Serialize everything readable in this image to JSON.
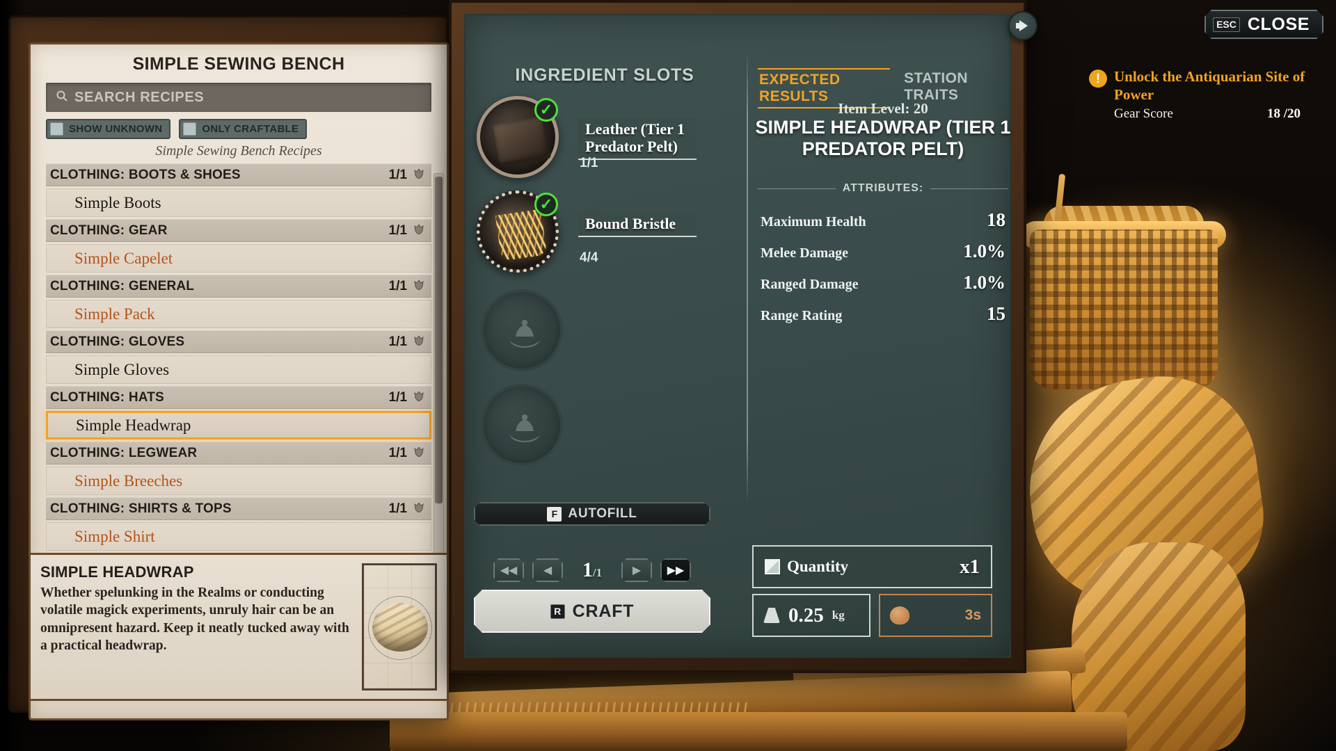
{
  "hud": {
    "mute_icon": "speaker-icon",
    "close_key": "ESC",
    "close_label": "CLOSE"
  },
  "quest": {
    "icon": "quest-alert-icon",
    "icon_glyph": "!",
    "title": "Unlock the Antiquarian Site of Power",
    "objective_label": "Gear Score",
    "objective_value": "18 /20"
  },
  "recipe_panel": {
    "title": "SIMPLE SEWING BENCH",
    "search": {
      "placeholder": "SEARCH RECIPES",
      "value": "",
      "icon": "search-icon"
    },
    "filters": [
      {
        "label": "SHOW UNKNOWN",
        "checked": false
      },
      {
        "label": "ONLY CRAFTABLE",
        "checked": false
      }
    ],
    "section_label": "Simple Sewing Bench Recipes",
    "count_icon": "crown-icon",
    "groups": [
      {
        "category": "CLOTHING: BOOTS & SHOES",
        "count": "1/1",
        "items": [
          {
            "name": "Simple Boots",
            "state": "known",
            "selected": false
          }
        ]
      },
      {
        "category": "CLOTHING: GEAR",
        "count": "1/1",
        "items": [
          {
            "name": "Simple Capelet",
            "state": "unknown",
            "selected": false
          }
        ]
      },
      {
        "category": "CLOTHING: GENERAL",
        "count": "1/1",
        "items": [
          {
            "name": "Simple Pack",
            "state": "unknown",
            "selected": false
          }
        ]
      },
      {
        "category": "CLOTHING: GLOVES",
        "count": "1/1",
        "items": [
          {
            "name": "Simple Gloves",
            "state": "known",
            "selected": false
          }
        ]
      },
      {
        "category": "CLOTHING: HATS",
        "count": "1/1",
        "items": [
          {
            "name": "Simple Headwrap",
            "state": "known",
            "selected": true
          }
        ]
      },
      {
        "category": "CLOTHING: LEGWEAR",
        "count": "1/1",
        "items": [
          {
            "name": "Simple Breeches",
            "state": "unknown",
            "selected": false
          }
        ]
      },
      {
        "category": "CLOTHING: SHIRTS & TOPS",
        "count": "1/1",
        "items": [
          {
            "name": "Simple Shirt",
            "state": "unknown",
            "selected": false
          }
        ]
      }
    ]
  },
  "description": {
    "title": "SIMPLE HEADWRAP",
    "body": "Whether spelunking in the Realms or conducting volatile magick experiments, unruly hair can be an omnipresent hazard. Keep it neatly tucked away with a practical headwrap.",
    "thumbnail": "headwrap-blueprint-image"
  },
  "ingredients": {
    "title": "INGREDIENT SLOTS",
    "slots": [
      {
        "name": "Leather (Tier 1 Predator Pelt)",
        "count": "1/1",
        "filled": true,
        "check_icon": "check-icon",
        "art": "leather-icon",
        "style": "plain"
      },
      {
        "name": "Bound Bristle",
        "count": "4/4",
        "filled": true,
        "check_icon": "check-icon",
        "art": "bristle-icon",
        "style": "fancy"
      },
      {
        "name": "",
        "count": "",
        "filled": false,
        "art": "empty-slot-icon",
        "style": "empty"
      },
      {
        "name": "",
        "count": "",
        "filled": false,
        "art": "empty-slot-icon",
        "style": "empty"
      }
    ],
    "autofill": {
      "key": "F",
      "label": "AUTOFILL"
    },
    "stepper": {
      "first_label": "◀◀",
      "prev_label": "◀",
      "next_label": "▶",
      "last_label": "▶▶",
      "current": "1",
      "max": "/1"
    },
    "craft": {
      "key": "R",
      "label": "CRAFT"
    }
  },
  "results": {
    "tabs": [
      {
        "label": "EXPECTED RESULTS",
        "active": true
      },
      {
        "label": "STATION TRAITS",
        "active": false
      }
    ],
    "item_level": "Item Level: 20",
    "item_name": "SIMPLE HEADWRAP (TIER 1 PREDATOR PELT)",
    "attributes_header": "ATTRIBUTES:",
    "attributes": [
      {
        "name": "Maximum Health",
        "value": "18"
      },
      {
        "name": "Melee Damage",
        "value": "1.0%"
      },
      {
        "name": "Ranged Damage",
        "value": "1.0%"
      },
      {
        "name": "Range Rating",
        "value": "15"
      }
    ],
    "quantity": {
      "icon": "cube-icon",
      "label": "Quantity",
      "value": "x1"
    },
    "weight": {
      "icon": "weight-icon",
      "value": "0.25",
      "unit": "kg"
    },
    "craft_time": {
      "icon": "craft-time-icon",
      "value": "3s"
    }
  },
  "colors": {
    "accent_orange": "#f2a324",
    "unknown_recipe": "#b4541c",
    "panel_teal": "#3f5250",
    "parchment": "#e6dccd",
    "check_green": "#4ee13f",
    "copper": "#c08553"
  }
}
